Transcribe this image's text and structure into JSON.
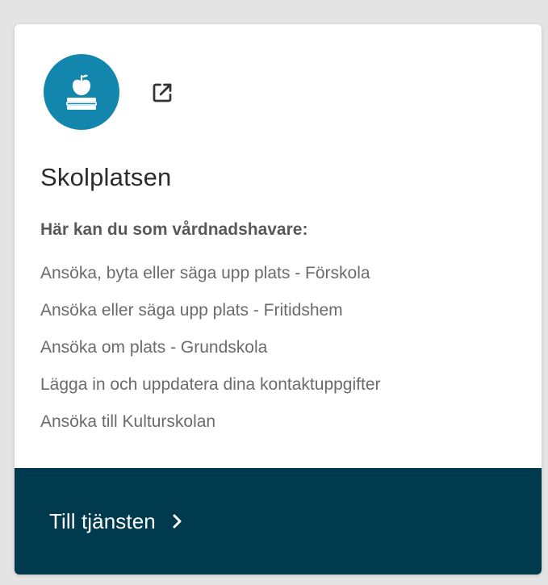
{
  "card": {
    "icon": "school-apple-book-icon",
    "external_icon": "external-link-icon",
    "title": "Skolplatsen",
    "intro": "Här kan du som vårdnadshavare:",
    "items": [
      "Ansöka, byta eller säga upp plats - Förskola",
      "Ansöka eller säga upp plats - Fritidshem",
      "Ansöka om plats - Grundskola",
      "Lägga in och uppdatera dina kontaktuppgifter",
      "Ansöka till Kulturskolan"
    ],
    "cta_label": "Till tjänsten",
    "cta_icon": "chevron-right-icon"
  },
  "colors": {
    "icon_circle": "#1286ad",
    "footer": "#003a4f",
    "background": "#e4e4e4"
  }
}
